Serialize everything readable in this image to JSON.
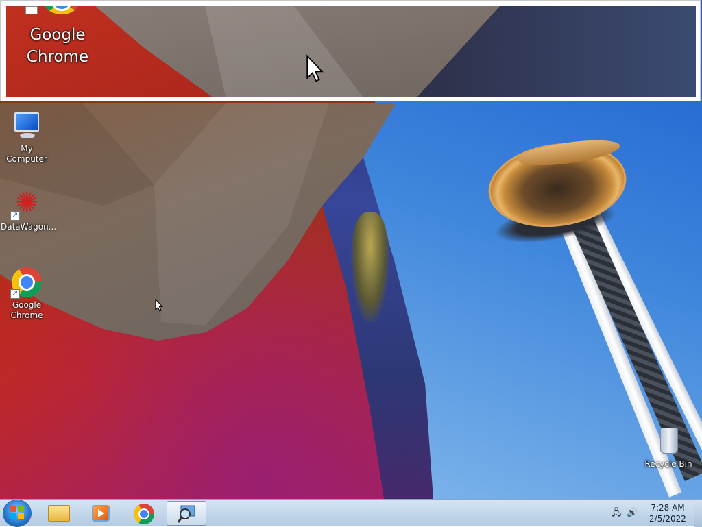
{
  "preview": {
    "label": "Google\nChrome"
  },
  "desktop_icons": [
    {
      "label": "My Computer",
      "icon": "computer-icon"
    },
    {
      "label": "DataWagon...",
      "icon": "datawagon-icon"
    },
    {
      "label": "Google Chrome",
      "icon": "chrome-icon"
    },
    {
      "label": "Recycle Bin",
      "icon": "recycle-bin-icon"
    }
  ],
  "taskbar": {
    "start": "start-button",
    "pinned": [
      {
        "icon": "windows-explorer-icon"
      },
      {
        "icon": "media-player-icon"
      },
      {
        "icon": "chrome-icon"
      },
      {
        "icon": "magnifier-icon",
        "active": true
      }
    ],
    "tray": {
      "icons": [
        "network-icon",
        "volume-icon"
      ],
      "time": "7:28 AM",
      "date": "2/5/2022"
    }
  }
}
